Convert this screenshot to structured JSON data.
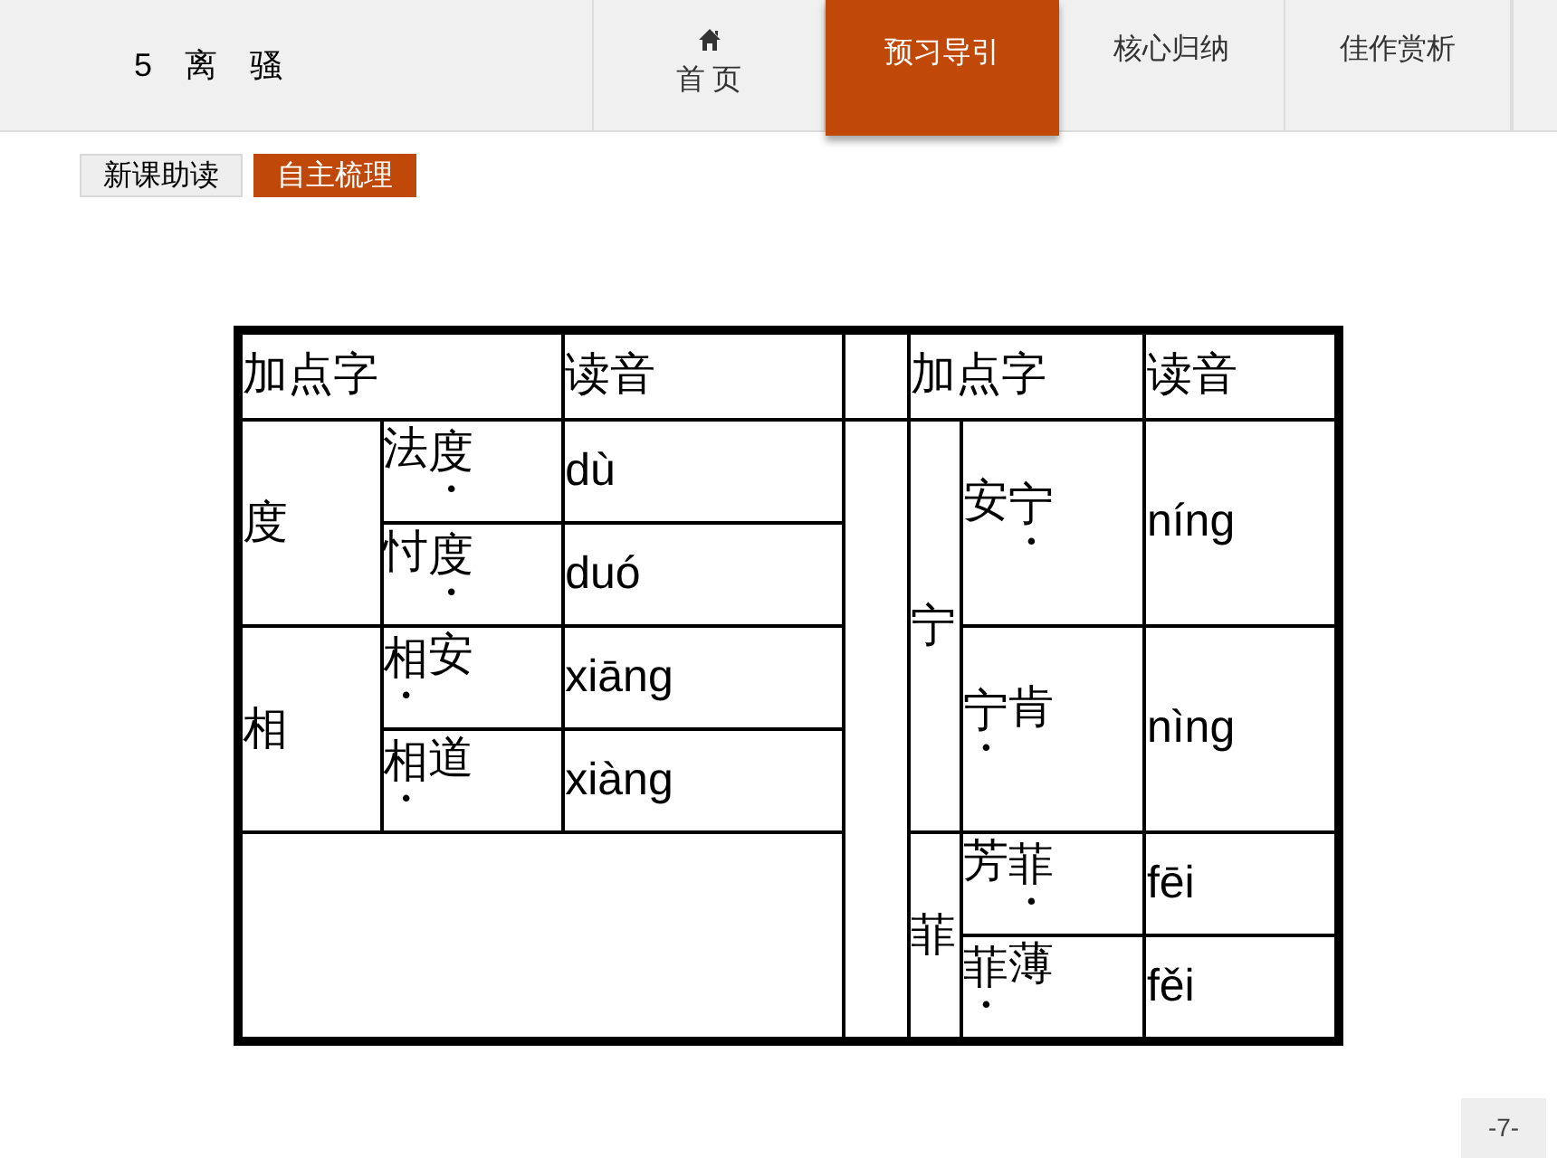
{
  "header": {
    "title": "5　离　骚",
    "home": "首 页",
    "tabs": [
      {
        "label": "预习导引",
        "selected": true
      },
      {
        "label": "核心归纳",
        "selected": false
      },
      {
        "label": "佳作赏析",
        "selected": false
      }
    ]
  },
  "subtabs": [
    {
      "label": "新课助读",
      "selected": false
    },
    {
      "label": "自主梳理",
      "selected": true
    }
  ],
  "table": {
    "headers_left": [
      "加点字",
      "读音"
    ],
    "headers_right": [
      "加点字",
      "读音"
    ],
    "left_groups": [
      {
        "char": "度",
        "entries": [
          {
            "parts": [
              {
                "text": "法",
                "dotted": false
              },
              {
                "text": "度",
                "dotted": true
              }
            ],
            "reading": "dù"
          },
          {
            "parts": [
              {
                "text": "忖",
                "dotted": false
              },
              {
                "text": "度",
                "dotted": true
              }
            ],
            "reading": "duó"
          }
        ]
      },
      {
        "char": "相",
        "entries": [
          {
            "parts": [
              {
                "text": "相",
                "dotted": true
              },
              {
                "text": "安",
                "dotted": false
              }
            ],
            "reading": "xiāng"
          },
          {
            "parts": [
              {
                "text": "相",
                "dotted": true
              },
              {
                "text": "道",
                "dotted": false
              }
            ],
            "reading": "xiàng"
          }
        ]
      }
    ],
    "right_groups": [
      {
        "char": "宁",
        "entries": [
          {
            "parts": [
              {
                "text": "安",
                "dotted": false
              },
              {
                "text": "宁",
                "dotted": true
              }
            ],
            "reading": "níng"
          },
          {
            "parts": [
              {
                "text": "宁",
                "dotted": true
              },
              {
                "text": "肯",
                "dotted": false
              }
            ],
            "reading": "nìng"
          }
        ]
      },
      {
        "char": "菲",
        "entries": [
          {
            "parts": [
              {
                "text": "芳",
                "dotted": false
              },
              {
                "text": "菲",
                "dotted": true
              }
            ],
            "reading": "fēi"
          },
          {
            "parts": [
              {
                "text": "菲",
                "dotted": true
              },
              {
                "text": "薄",
                "dotted": false
              }
            ],
            "reading": "fěi"
          }
        ]
      }
    ]
  },
  "page_number": "-7-"
}
